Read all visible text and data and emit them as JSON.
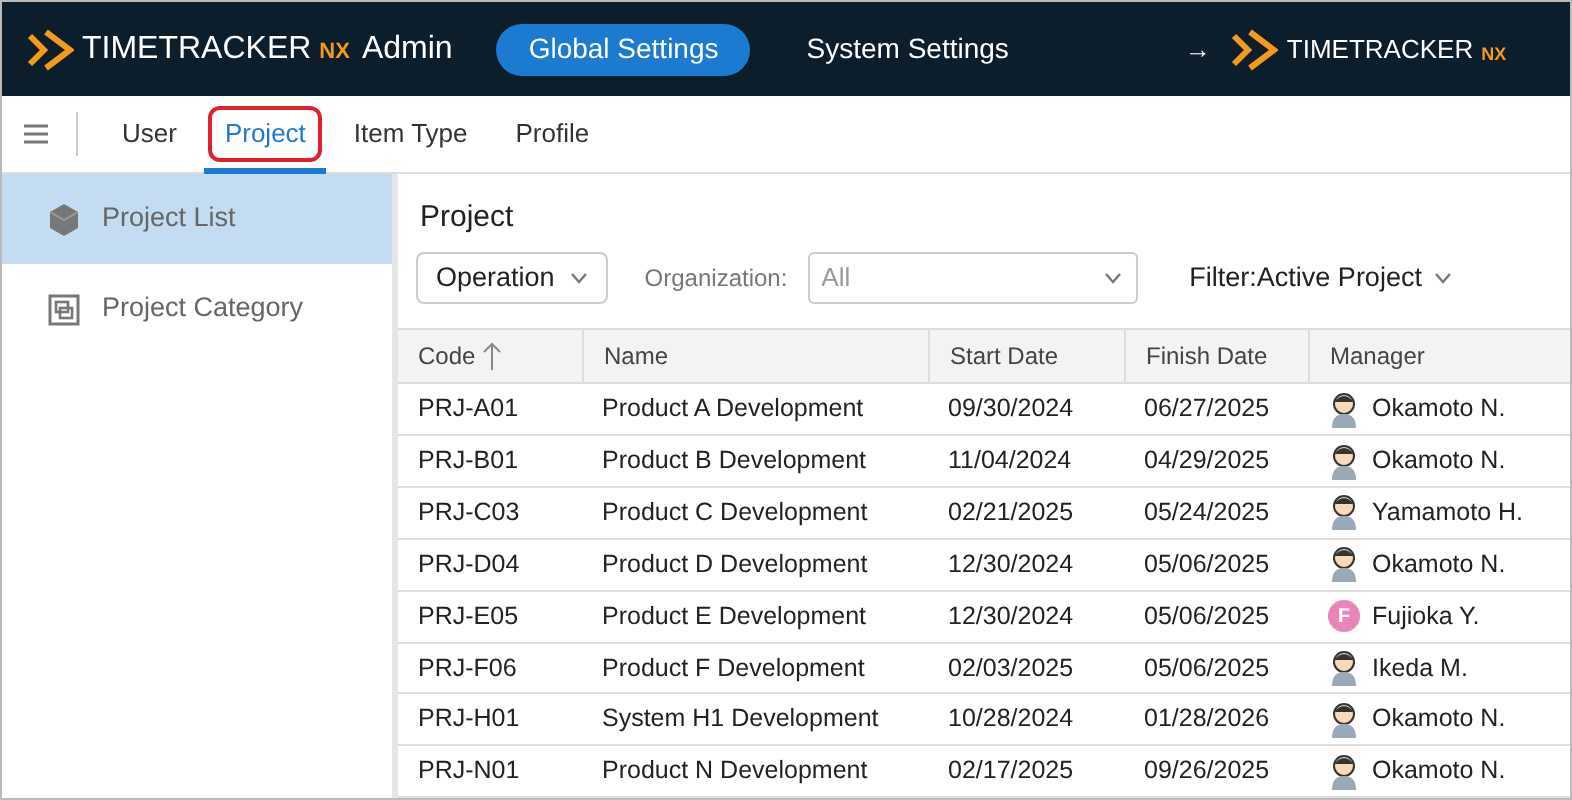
{
  "header": {
    "logo": {
      "name": "TIMETRACKER",
      "suffix": "NX"
    },
    "app_label": "Admin",
    "nav": [
      {
        "label": "Global Settings",
        "selected": true
      },
      {
        "label": "System Settings",
        "selected": false
      }
    ],
    "link": {
      "arrow": "→",
      "logo": {
        "name": "TIMETRACKER",
        "suffix": "NX"
      }
    }
  },
  "tabs": [
    {
      "label": "User",
      "selected": false,
      "highlighted": false
    },
    {
      "label": "Project",
      "selected": true,
      "highlighted": true
    },
    {
      "label": "Item Type",
      "selected": false,
      "highlighted": false
    },
    {
      "label": "Profile",
      "selected": false,
      "highlighted": false
    }
  ],
  "sidebar": {
    "items": [
      {
        "label": "Project List",
        "kind": "cube",
        "selected": true
      },
      {
        "label": "Project Category",
        "kind": "category",
        "selected": false
      }
    ]
  },
  "main": {
    "title": "Project",
    "type_dropdown": "Operation",
    "organization_label": "Organization:",
    "organization_placeholder": "All",
    "filter": "Filter:Active Project",
    "table": {
      "columns": [
        {
          "label": "Code",
          "sorted": true
        },
        {
          "label": "Name",
          "sorted": false
        },
        {
          "label": "Start Date",
          "sorted": false
        },
        {
          "label": "Finish Date",
          "sorted": false
        },
        {
          "label": "Manager",
          "sorted": false
        }
      ],
      "rows": [
        {
          "code": "PRJ-A01",
          "name": "Product A Development",
          "start": "09/30/2024",
          "finish": "06/27/2025",
          "manager": {
            "name": "Okamoto N.",
            "kind": "person"
          }
        },
        {
          "code": "PRJ-B01",
          "name": "Product B Development",
          "start": "11/04/2024",
          "finish": "04/29/2025",
          "manager": {
            "name": "Okamoto N.",
            "kind": "person"
          }
        },
        {
          "code": "PRJ-C03",
          "name": "Product C Development",
          "start": "02/21/2025",
          "finish": "05/24/2025",
          "manager": {
            "name": "Yamamoto H.",
            "kind": "person"
          }
        },
        {
          "code": "PRJ-D04",
          "name": "Product D Development",
          "start": "12/30/2024",
          "finish": "05/06/2025",
          "manager": {
            "name": "Okamoto N.",
            "kind": "person"
          }
        },
        {
          "code": "PRJ-E05",
          "name": "Product E Development",
          "start": "12/30/2024",
          "finish": "05/06/2025",
          "manager": {
            "name": "Fujioka Y.",
            "kind": "initial",
            "initial": "F",
            "color": "#e985b9"
          }
        },
        {
          "code": "PRJ-F06",
          "name": "Product F Development",
          "start": "02/03/2025",
          "finish": "05/06/2025",
          "manager": {
            "name": "Ikeda M.",
            "kind": "person"
          }
        },
        {
          "code": "PRJ-H01",
          "name": "System H1 Development",
          "start": "10/28/2024",
          "finish": "01/28/2026",
          "manager": {
            "name": "Okamoto N.",
            "kind": "person"
          }
        },
        {
          "code": "PRJ-N01",
          "name": "Product N Development",
          "start": "02/17/2025",
          "finish": "09/26/2025",
          "manager": {
            "name": "Okamoto N.",
            "kind": "person"
          }
        }
      ]
    }
  }
}
